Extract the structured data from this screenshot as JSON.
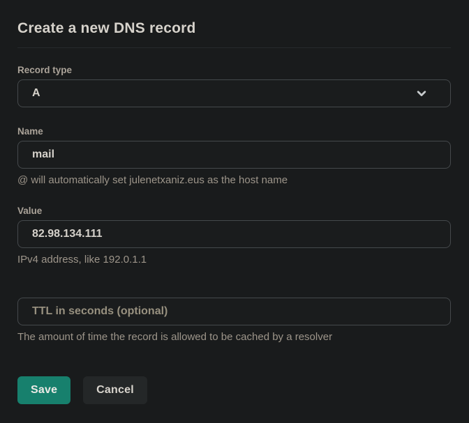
{
  "form": {
    "title": "Create a new DNS record",
    "record_type": {
      "label": "Record type",
      "selected_value": "A",
      "icon": "chevron-down"
    },
    "name": {
      "label": "Name",
      "value": "mail",
      "helper": "@ will automatically set julenetxaniz.eus as the host name"
    },
    "value": {
      "label": "Value",
      "value": "82.98.134.111",
      "helper": "IPv4 address, like 192.0.1.1"
    },
    "ttl": {
      "placeholder": "TTL in seconds (optional)",
      "helper": "The amount of time the record is allowed to be cached by a resolver"
    },
    "buttons": {
      "save": "Save",
      "cancel": "Cancel"
    },
    "colors": {
      "background": "#191b1c",
      "input_border": "#45494c",
      "save_button": "#17806d",
      "cancel_button": "#242728",
      "text_primary": "#d6d2cb",
      "text_muted": "#9d958a"
    }
  }
}
